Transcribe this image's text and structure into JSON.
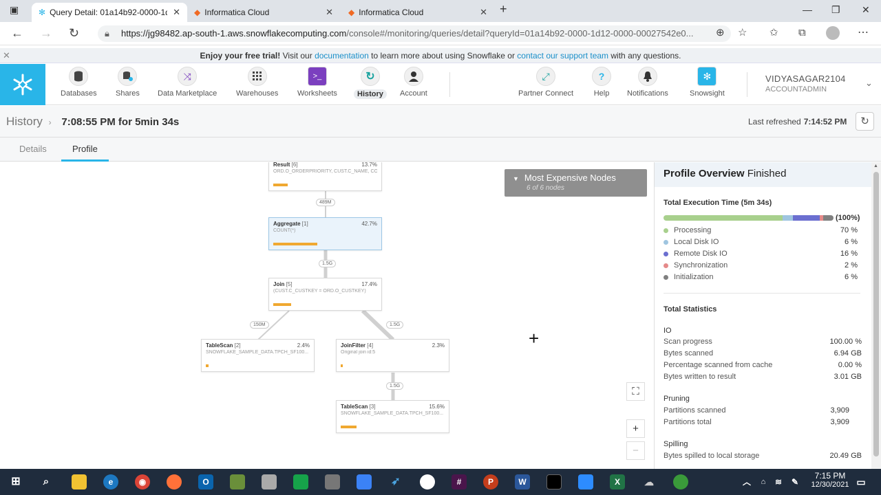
{
  "browser": {
    "tabs": [
      {
        "title": "Query Detail: 01a14b92-0000-1d"
      },
      {
        "title": "Informatica Cloud"
      },
      {
        "title": "Informatica Cloud"
      }
    ],
    "url_host": "https://jg98482.ap-south-1.aws.snowflakecomputing.com",
    "url_path": "/console#/monitoring/queries/detail?queryId=01a14b92-0000-1d12-0000-00027542e0..."
  },
  "trial": {
    "lead": "Enjoy your free trial!",
    "visit": "Visit our",
    "doc_link": "documentation",
    "mid": "to learn more about using Snowflake or",
    "support_link": "contact our support team",
    "tail": "with any questions."
  },
  "nav": {
    "items": [
      {
        "label": "Databases"
      },
      {
        "label": "Shares"
      },
      {
        "label": "Data Marketplace"
      },
      {
        "label": "Warehouses"
      },
      {
        "label": "Worksheets"
      },
      {
        "label": "History"
      },
      {
        "label": "Account"
      }
    ],
    "right_items": [
      {
        "label": "Partner Connect"
      },
      {
        "label": "Help"
      },
      {
        "label": "Notifications"
      },
      {
        "label": "Snowsight"
      }
    ],
    "user_name": "VIDYASAGAR2104",
    "user_role": "ACCOUNTADMIN"
  },
  "header": {
    "crumb": "History",
    "title": "7:08:55 PM for 5min 34s",
    "last_refreshed_label": "Last refreshed",
    "last_refreshed_value": "7:14:52 PM"
  },
  "tabs": {
    "details": "Details",
    "profile": "Profile"
  },
  "graph": {
    "nodes": [
      {
        "name": "Result",
        "idx": "[6]",
        "pct": "13.7%",
        "desc": "ORD.O_ORDERPRIORITY, CUST.C_NAME, CO...",
        "fill": 0.137
      },
      {
        "name": "Aggregate",
        "idx": "[1]",
        "pct": "42.7%",
        "desc": "COUNT(*)",
        "fill": 0.427
      },
      {
        "name": "Join",
        "idx": "[5]",
        "pct": "17.4%",
        "desc": "(CUST.C_CUSTKEY = ORD.O_CUSTKEY)",
        "fill": 0.174
      },
      {
        "name": "TableScan",
        "idx": "[2]",
        "pct": "2.4%",
        "desc": "SNOWFLAKE_SAMPLE_DATA.TPCH_SF100...",
        "fill": 0.024
      },
      {
        "name": "JoinFilter",
        "idx": "[4]",
        "pct": "2.3%",
        "desc": "Original join id:5",
        "fill": 0.023
      },
      {
        "name": "TableScan",
        "idx": "[3]",
        "pct": "15.6%",
        "desc": "SNOWFLAKE_SAMPLE_DATA.TPCH_SF100...",
        "fill": 0.156
      }
    ],
    "edges": [
      "489M",
      "1.5G",
      "150M",
      "1.5G",
      "1.5G"
    ],
    "expensive_title": "Most Expensive Nodes",
    "expensive_sub": "6 of 6 nodes"
  },
  "overview": {
    "title": "Profile Overview",
    "status": "Finished",
    "exec_title": "Total Execution Time (5m 34s)",
    "exec_total": "(100%)",
    "breakdown": [
      {
        "label": "Processing",
        "value": "70 %",
        "color": "#a8d08d",
        "fraction": 0.7
      },
      {
        "label": "Local Disk IO",
        "value": "6 %",
        "color": "#9fc5e0",
        "fraction": 0.06
      },
      {
        "label": "Remote Disk IO",
        "value": "16 %",
        "color": "#6b6fd0",
        "fraction": 0.16
      },
      {
        "label": "Synchronization",
        "value": "2 %",
        "color": "#e58a8a",
        "fraction": 0.02
      },
      {
        "label": "Initialization",
        "value": "6 %",
        "color": "#808080",
        "fraction": 0.06
      }
    ],
    "stats_title": "Total Statistics",
    "io_title": "IO",
    "io": [
      {
        "label": "Scan progress",
        "value": "100.00 %"
      },
      {
        "label": "Bytes scanned",
        "value": "6.94 GB"
      },
      {
        "label": "Percentage scanned from cache",
        "value": "0.00 %"
      },
      {
        "label": "Bytes written to result",
        "value": "3.01 GB"
      }
    ],
    "pruning_title": "Pruning",
    "pruning": [
      {
        "label": "Partitions scanned",
        "value": "3,909"
      },
      {
        "label": "Partitions total",
        "value": "3,909"
      }
    ],
    "spilling_title": "Spilling",
    "spilling": [
      {
        "label": "Bytes spilled to local storage",
        "value": "20.49 GB"
      }
    ]
  },
  "taskbar": {
    "time": "7:15 PM",
    "date": "12/30/2021"
  }
}
